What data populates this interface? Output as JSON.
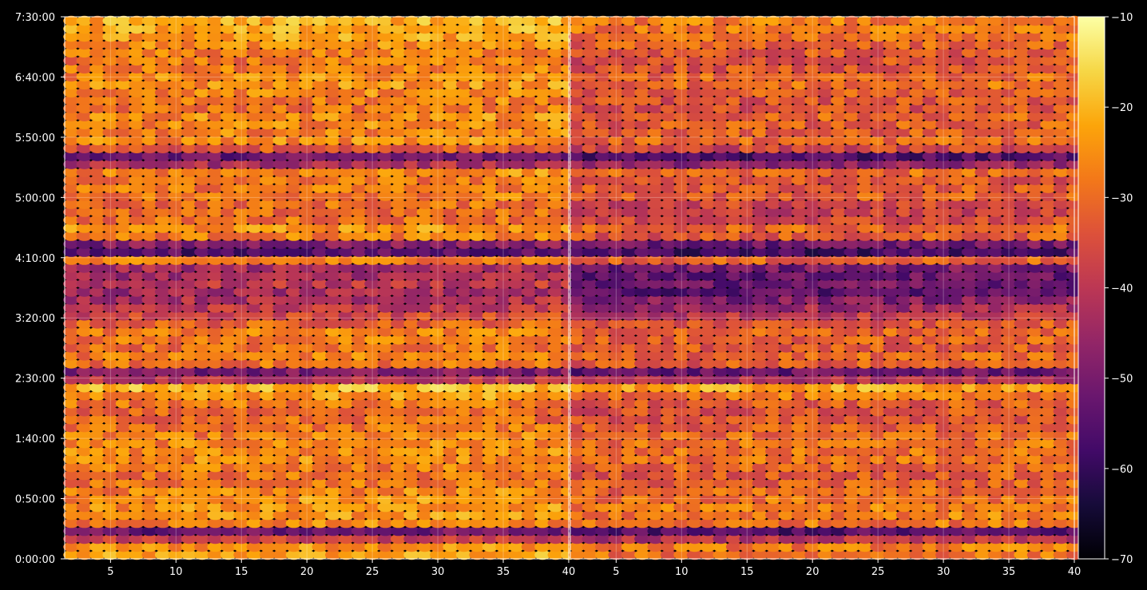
{
  "chart_data": {
    "type": "heatmap",
    "title": "",
    "xlabel": "",
    "ylabel": "",
    "panels": [
      {
        "name": "",
        "x_range": [
          1.5,
          40
        ],
        "x_ticks": [
          5,
          10,
          15,
          20,
          25,
          30,
          35,
          40
        ],
        "x_tick_labels": [
          "5",
          "10",
          "15",
          "20",
          "25",
          "30",
          "35",
          "40"
        ]
      },
      {
        "name": "",
        "x_range": [
          1.5,
          40
        ],
        "x_ticks": [
          5,
          10,
          15,
          20,
          25,
          30,
          35,
          40
        ],
        "x_tick_labels": [
          "5",
          "10",
          "15",
          "20",
          "25",
          "30",
          "35",
          "40"
        ]
      }
    ],
    "y_ticks_seconds": [
      0,
      3000,
      6000,
      9000,
      12000,
      15000,
      18000,
      21000,
      24000,
      27000
    ],
    "y_tick_labels": [
      "0:00:00",
      "0:50:00",
      "1:40:00",
      "2:30:00",
      "3:20:00",
      "4:10:00",
      "5:00:00",
      "5:50:00",
      "6:40:00",
      "7:30:00"
    ],
    "ylim_seconds": [
      0,
      27000
    ],
    "grid": true,
    "colormap": "inferno",
    "colorbar": {
      "range": [
        -70,
        -10
      ],
      "ticks": [
        -70,
        -60,
        -50,
        -40,
        -30,
        -20,
        -10
      ],
      "tick_labels": [
        "−70",
        "−60",
        "−50",
        "−40",
        "−30",
        "−20",
        "−10"
      ]
    },
    "band_profile": {
      "times_seconds": [
        300,
        800,
        1300,
        1700,
        2300,
        3000,
        3500,
        4300,
        5000,
        5700,
        6400,
        7200,
        7800,
        8100,
        8600,
        9200,
        9800,
        10500,
        11300,
        11700,
        12200,
        12800,
        13300,
        13800,
        14400,
        14900,
        15400,
        16200,
        16800,
        17400,
        18200,
        18800,
        19400,
        19900,
        20600,
        21400,
        22000,
        22400,
        23100,
        23800,
        24600,
        25300,
        26000,
        26700
      ],
      "panel_1_levels": [
        -24,
        -26,
        -60,
        -28,
        -25,
        -26,
        -28,
        -30,
        -26,
        -27,
        -29,
        -32,
        -28,
        -25,
        -20,
        -58,
        -26,
        -30,
        -28,
        -32,
        -38,
        -42,
        -45,
        -40,
        -48,
        -28,
        -64,
        -22,
        -30,
        -32,
        -28,
        -30,
        -26,
        -60,
        -26,
        -28,
        -26,
        -30,
        -28,
        -25,
        -30,
        -28,
        -24,
        -22
      ],
      "panel_2_levels": [
        -30,
        -28,
        -64,
        -30,
        -28,
        -30,
        -32,
        -34,
        -30,
        -30,
        -32,
        -36,
        -34,
        -30,
        -22,
        -60,
        -30,
        -34,
        -32,
        -34,
        -42,
        -48,
        -55,
        -52,
        -56,
        -32,
        -66,
        -28,
        -36,
        -40,
        -32,
        -36,
        -30,
        -64,
        -30,
        -34,
        -32,
        -36,
        -34,
        -30,
        -36,
        -34,
        -30,
        -28
      ]
    }
  }
}
